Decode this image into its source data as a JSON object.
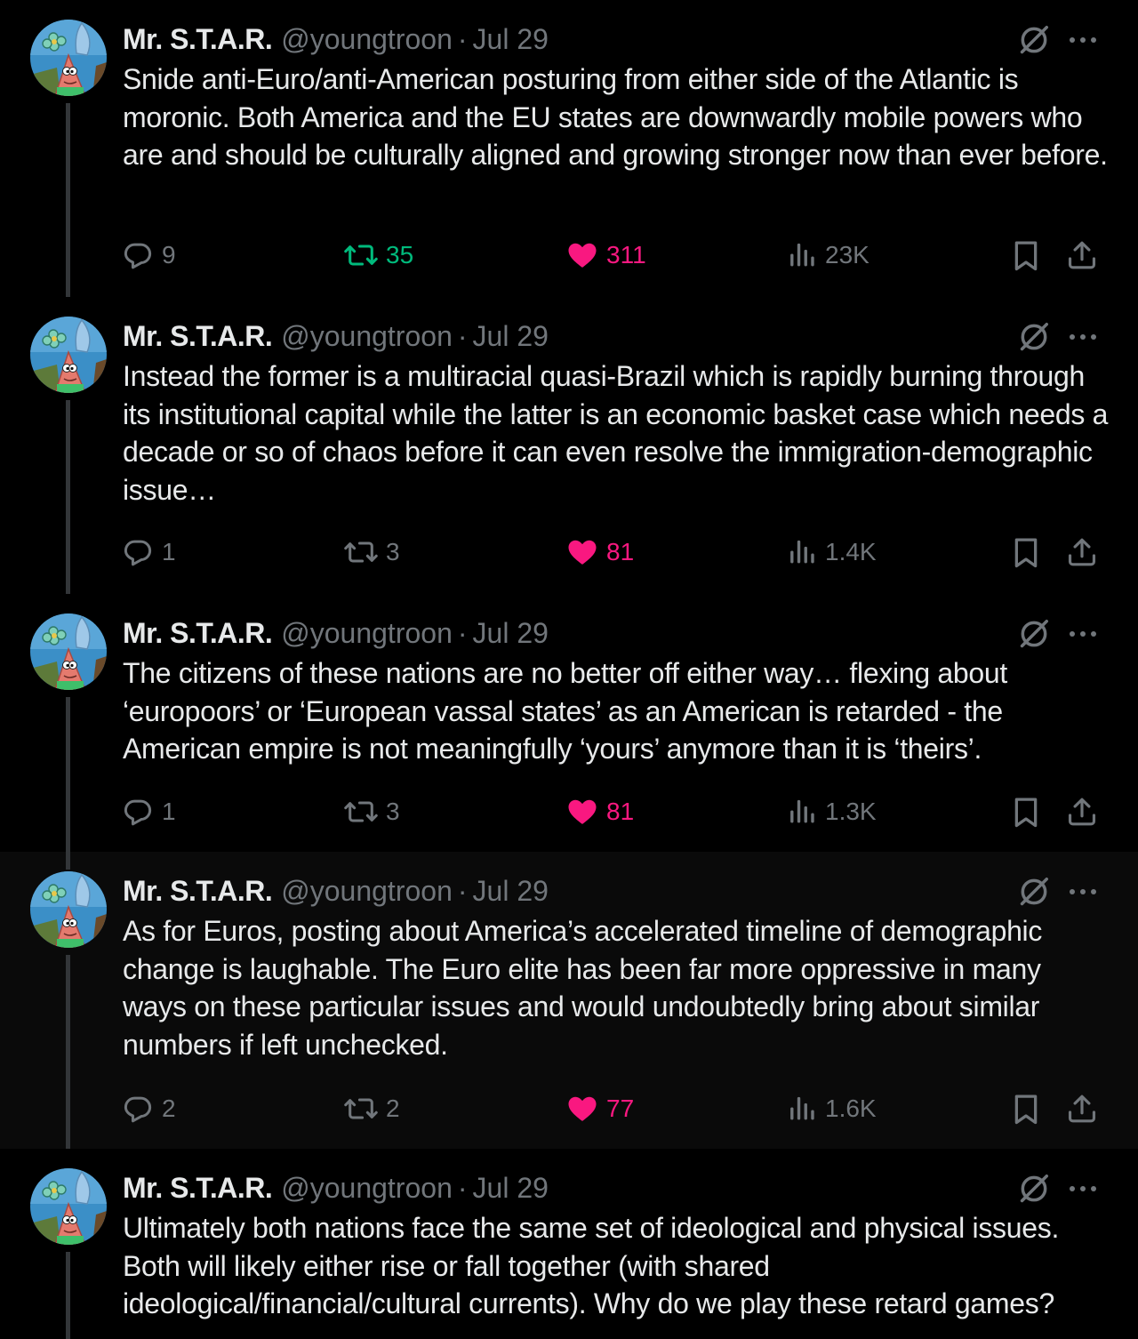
{
  "colors": {
    "background": "#000000",
    "highlight_background": "#0a0a0a",
    "text": "#e7e9ea",
    "secondary": "#71767b",
    "retweet_active": "#00ba7c",
    "like_active": "#f91880",
    "thread_line": "#333639"
  },
  "icons": {
    "reply": "speech-bubble-icon",
    "retweet": "retweet-arrows-icon",
    "like": "heart-icon",
    "views": "bar-chart-icon",
    "bookmark": "bookmark-icon",
    "share": "upload-share-icon",
    "grok": "grok-slash-circle-icon",
    "more": "more-dots-icon"
  },
  "tweets": [
    {
      "name": "Mr. S.T.A.R.",
      "handle": "@youngtroon",
      "separator": "·",
      "time": "Jul 29",
      "text": "Snide anti-Euro/anti-American posturing from either side of the Atlantic is moronic. Both America and the EU states are downwardly mobile powers who are and should be culturally aligned and growing stronger now than ever before.",
      "replies": "9",
      "retweets": "35",
      "retweeted": true,
      "likes": "311",
      "liked": true,
      "views": "23K"
    },
    {
      "name": "Mr. S.T.A.R.",
      "handle": "@youngtroon",
      "separator": "·",
      "time": "Jul 29",
      "text": "Instead the former is a multiracial quasi-Brazil which is rapidly burning through its institutional capital while the latter is an economic basket case which needs a decade or so of chaos before it can even resolve the immigration-demographic issue…",
      "replies": "1",
      "retweets": "3",
      "retweeted": false,
      "likes": "81",
      "liked": true,
      "views": "1.4K"
    },
    {
      "name": "Mr. S.T.A.R.",
      "handle": "@youngtroon",
      "separator": "·",
      "time": "Jul 29",
      "text": "The citizens of these nations are no better off either way… flexing about ‘europoors’ or ‘European vassal states’ as an American is retarded - the American empire is not meaningfully ‘yours’ anymore than it is ‘theirs’.",
      "replies": "1",
      "retweets": "3",
      "retweeted": false,
      "likes": "81",
      "liked": true,
      "views": "1.3K"
    },
    {
      "name": "Mr. S.T.A.R.",
      "handle": "@youngtroon",
      "separator": "·",
      "time": "Jul 29",
      "text": "As for Euros, posting about America’s accelerated timeline of demographic change is laughable. The Euro elite has been far more oppressive in many ways on these particular issues and would undoubtedly bring about similar numbers if left unchecked.",
      "replies": "2",
      "retweets": "2",
      "retweeted": false,
      "likes": "77",
      "liked": true,
      "views": "1.6K"
    },
    {
      "name": "Mr. S.T.A.R.",
      "handle": "@youngtroon",
      "separator": "·",
      "time": "Jul 29",
      "text": "Ultimately both nations face the same set of ideological and physical issues. Both will likely either rise or fall together (with shared ideological/financial/cultural currents). Why do we play these retard games?"
    }
  ]
}
